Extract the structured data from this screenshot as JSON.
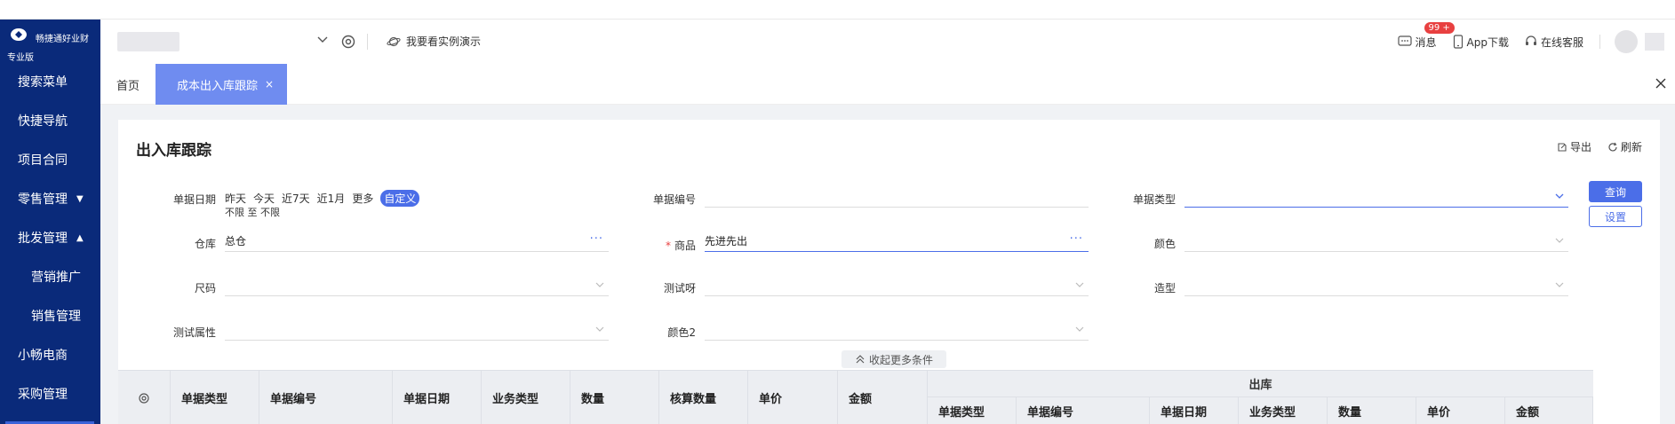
{
  "brand": {
    "name": "畅捷通好业财",
    "edition": "专业版"
  },
  "sidebar": {
    "items": [
      {
        "label": "搜索菜单"
      },
      {
        "label": "快捷导航"
      },
      {
        "label": "项目合同"
      },
      {
        "label": "零售管理",
        "caret": "▼"
      },
      {
        "label": "批发管理",
        "caret": "▲"
      },
      {
        "label": "营销推广"
      },
      {
        "label": "销售管理"
      },
      {
        "label": "小畅电商"
      },
      {
        "label": "采购管理"
      }
    ]
  },
  "header": {
    "demo_label": "我要看实例演示",
    "messages_label": "消息",
    "messages_badge": "99 +",
    "app_label": "App下载",
    "service_label": "在线客服"
  },
  "tabs": {
    "home": "首页",
    "active": "成本出入库跟踪",
    "close": "×"
  },
  "page": {
    "title": "出入库跟踪",
    "export_label": "导出",
    "refresh_label": "刷新"
  },
  "filters": {
    "date_label": "单据日期",
    "quick_dates": [
      "昨天",
      "今天",
      "近7天",
      "近1月",
      "更多",
      "自定义"
    ],
    "date_range": "不限 至 不限",
    "doc_no_label": "单据编号",
    "doc_type_label": "单据类型",
    "warehouse_label": "仓库",
    "warehouse_value": "总仓",
    "product_label": "商品",
    "product_value": "先进先出",
    "color_label": "颜色",
    "size_label": "尺码",
    "test_label": "测试呀",
    "style_label": "造型",
    "test_attr_label": "测试属性",
    "color2_label": "颜色2",
    "query_button": "查询",
    "settings_button": "设置",
    "collapse_label": "收起更多条件"
  },
  "table": {
    "columns": [
      "单据类型",
      "单据编号",
      "单据日期",
      "业务类型",
      "数量",
      "核算数量",
      "单价",
      "金额"
    ],
    "group_label": "出库",
    "group_columns": [
      "单据类型",
      "单据编号",
      "单据日期",
      "业务类型",
      "数量",
      "单价",
      "金额"
    ]
  }
}
